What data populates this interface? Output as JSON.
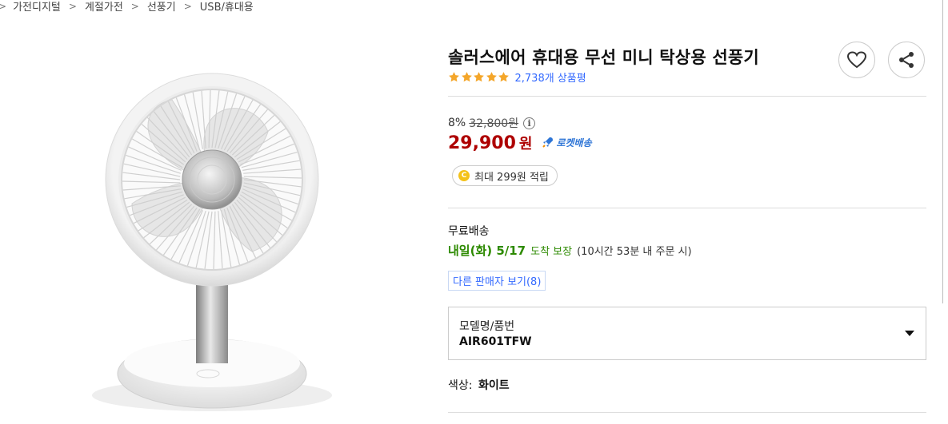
{
  "breadcrumb": {
    "items": [
      "가전디지털",
      "계절가전",
      "선풍기",
      "USB/휴대용"
    ],
    "separator": ">"
  },
  "product": {
    "title": "솔러스에어 휴대용 무선 미니 탁상용 선풍기",
    "rating": 5,
    "review_count": "2,738개 상품평",
    "favorite_icon": "heart-icon",
    "share_icon": "share-icon"
  },
  "price": {
    "discount": "8%",
    "original": "32,800원",
    "info_icon": "i",
    "sale": "29,900",
    "currency": "원",
    "rocket_label": "로켓배송",
    "reward_coin": "C",
    "reward": "최대 299원 적립"
  },
  "shipping": {
    "label": "무료배송",
    "date": "내일(화) 5/17",
    "guarantee": "도착 보장",
    "note": "(10시간 53분 내 주문 시)",
    "other_sellers": "다른 판매자 보기(8)"
  },
  "options": {
    "label": "모델명/품번",
    "value": "AIR601TFW"
  },
  "color": {
    "label": "색상:",
    "value": "화이트"
  },
  "colors": {
    "sale_red": "#ae0000",
    "link_blue": "#346aff",
    "delivery_green": "#2d8a00",
    "star_orange": "#f4a62a"
  }
}
